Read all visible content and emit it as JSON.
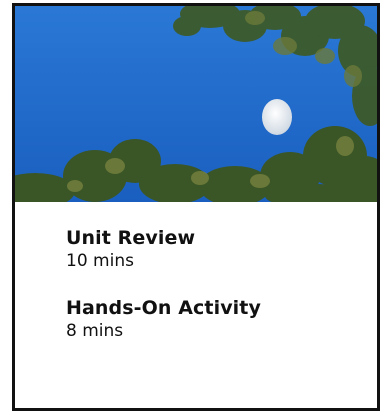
{
  "card": {
    "image": {
      "subject": "moon-in-sky-through-trees",
      "sky_color": "#1f6fd0",
      "foliage_color": "#3a5a2a",
      "moon_color": "#eef2f6"
    },
    "lessons": [
      {
        "title": "Unit Review",
        "duration": "10 mins"
      },
      {
        "title": "Hands-On Activity",
        "duration": "8 mins"
      }
    ]
  }
}
